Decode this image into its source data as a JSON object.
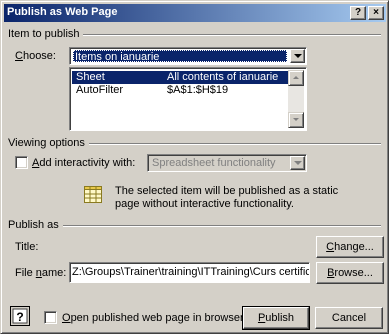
{
  "window": {
    "title": "Publish as Web Page",
    "help_button": "?",
    "close_button": "×"
  },
  "item_to_publish": {
    "section_label": "Item to publish",
    "choose_label": "Choose:",
    "choose_value": "Items on ianuarie",
    "list": [
      {
        "name": "Sheet",
        "desc": "All contents of ianuarie",
        "selected": true
      },
      {
        "name": "AutoFilter",
        "desc": "$A$1:$H$19",
        "selected": false
      }
    ]
  },
  "viewing_options": {
    "section_label": "Viewing options",
    "interactivity_label": "Add interactivity with:",
    "interactivity_checked": false,
    "interactivity_value": "Spreadsheet functionality",
    "info_text_line1": "The selected item will be published as a static",
    "info_text_line2": "page without interactive functionality.",
    "info_icon": "spreadsheet-icon"
  },
  "publish_as": {
    "section_label": "Publish as",
    "title_label": "Title:",
    "change_button": "Change...",
    "filename_label": "File name:",
    "filename_value": "Z:\\Groups\\Trainer\\training\\ITTraining\\Curs certificare\\",
    "browse_button": "Browse..."
  },
  "footer": {
    "help_icon": "help-icon",
    "open_browser_label": "Open published web page in browser",
    "open_browser_checked": false,
    "publish_button": "Publish",
    "cancel_button": "Cancel"
  },
  "colors": {
    "dialog_bg": "#d4d0c8",
    "titlebar_start": "#0a246a",
    "titlebar_end": "#a6caf0",
    "selection": "#0a246a"
  }
}
